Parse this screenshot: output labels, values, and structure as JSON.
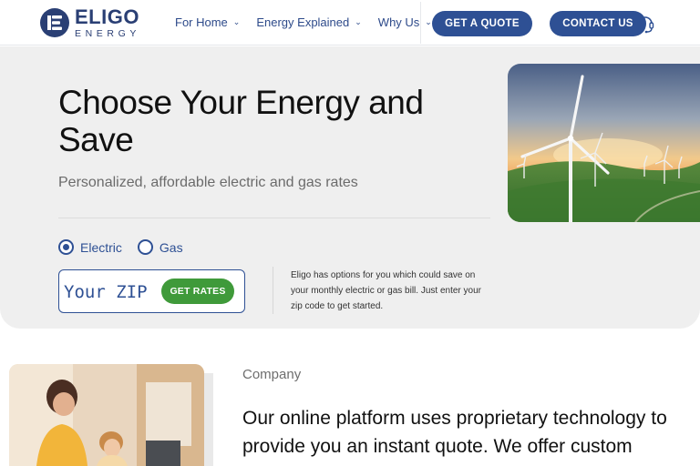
{
  "brand": {
    "name": "ELIGO",
    "tagline": "ENERGY",
    "color": "#2a3f74"
  },
  "nav": {
    "items": [
      {
        "label": "For Home"
      },
      {
        "label": "Energy Explained"
      },
      {
        "label": "Why Us"
      }
    ],
    "quote_button": "GET A QUOTE",
    "contact_button": "CONTACT US"
  },
  "hero": {
    "title": "Choose Your Energy and Save",
    "subtitle": "Personalized, affordable electric and gas rates",
    "radio": {
      "electric": "Electric",
      "gas": "Gas",
      "selected": "Electric"
    },
    "zip_placeholder": "Your ZIP",
    "rates_button": "GET RATES",
    "note": "Eligo has options for you which could save on your monthly electric or gas bill. Just enter your zip code to get started."
  },
  "company": {
    "label": "Company",
    "text": "Our online platform uses proprietary technology to provide you an instant quote. We offer custom"
  },
  "colors": {
    "primary": "#2e5094",
    "accent_green": "#3f9a3a",
    "hero_bg": "#efefef"
  },
  "icons": [
    "logo-e-icon",
    "chevron-down-icon",
    "headset-icon"
  ]
}
